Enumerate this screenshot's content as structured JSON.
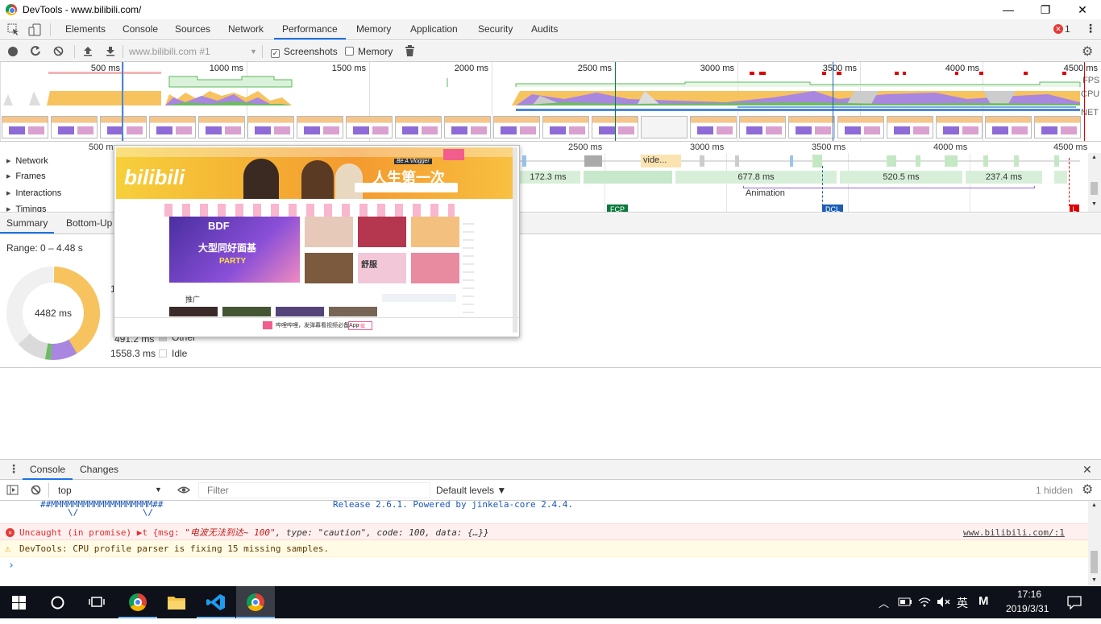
{
  "window": {
    "title": "DevTools - www.bilibili.com/",
    "min": "—",
    "restore": "❐",
    "close": "✕"
  },
  "tabs": [
    "Elements",
    "Console",
    "Sources",
    "Network",
    "Performance",
    "Memory",
    "Application",
    "Security",
    "Audits"
  ],
  "errors_count": "1",
  "perf_toolbar": {
    "recording": "www.bilibili.com #1",
    "screenshots": "Screenshots",
    "memory": "Memory"
  },
  "overview": {
    "ticks": [
      "500 ms",
      "1000 ms",
      "1500 ms",
      "2000 ms",
      "2500 ms",
      "3000 ms",
      "3500 ms",
      "4000 ms",
      "4500 ms"
    ],
    "labels": {
      "fps": "FPS",
      "cpu": "CPU",
      "net": "NET"
    }
  },
  "timeline": {
    "ticks": [
      "500 m",
      "2500 ms",
      "3000 ms",
      "3500 ms",
      "4000 ms",
      "4500 ms"
    ],
    "rows": [
      "Network",
      "Frames",
      "Interactions",
      "Timings"
    ],
    "frames": [
      "172.3 ms",
      "677.8 ms",
      "520.5 ms",
      "237.4 ms"
    ],
    "net_label": "vide...",
    "animation": "Animation",
    "markers": {
      "fcp": "FCP",
      "dcl": "DCL",
      "l": "L"
    }
  },
  "summary": {
    "tabs": [
      "Summary",
      "Bottom-Up"
    ],
    "range": "Range: 0 – 4.48 s",
    "total": "4482 ms",
    "legend": [
      {
        "value": "491.2 ms",
        "label": "Other"
      },
      {
        "value": "1558.3 ms",
        "label": "Idle"
      }
    ],
    "partial": "1"
  },
  "screenshot_popup": {
    "brand": "bilibili",
    "banner": "人生第一次",
    "banner_tag": "Be A Vlogger",
    "bdf": "BDF",
    "bdf_title": "大型同好面基",
    "party": "PARTY",
    "section": "推广",
    "footer": "哔哩哔哩，发弹幕看视频必备App",
    "footer_btn": "下载",
    "comfort": "舒服"
  },
  "console": {
    "tabs": [
      "Console",
      "Changes"
    ],
    "context": "top",
    "filter_placeholder": "Filter",
    "levels": "Default levels ▼",
    "hidden": "1 hidden",
    "lines": {
      "ascii": "##MMMMMMMMMMMMMMMMMMM##",
      "ascii2": "\\/            \\/",
      "release": "Release 2.6.1. Powered by jinkela-core 2.4.4.",
      "error_prefix": "Uncaught (in promise) ▶t {msg: ",
      "error_msg": "\"电波无法到达~ 100\"",
      "error_rest": ", type: \"caution\", code: 100, data: {…}}",
      "error_src": "www.bilibili.com/:1",
      "warn": "DevTools: CPU profile parser is fixing 15 missing samples.",
      "prompt": "›"
    }
  },
  "taskbar": {
    "time": "17:16",
    "date": "2019/3/31",
    "ime": "英",
    "ime2": "M"
  },
  "colors": {
    "accent": "#1a73e8",
    "error_bg": "#fff0f0",
    "warn_bg": "#fffbe5",
    "scripting": "#f7c35f",
    "rendering": "#a986e0",
    "painting": "#6cbd61",
    "idle": "#f0f0f0",
    "other": "#dadada"
  }
}
